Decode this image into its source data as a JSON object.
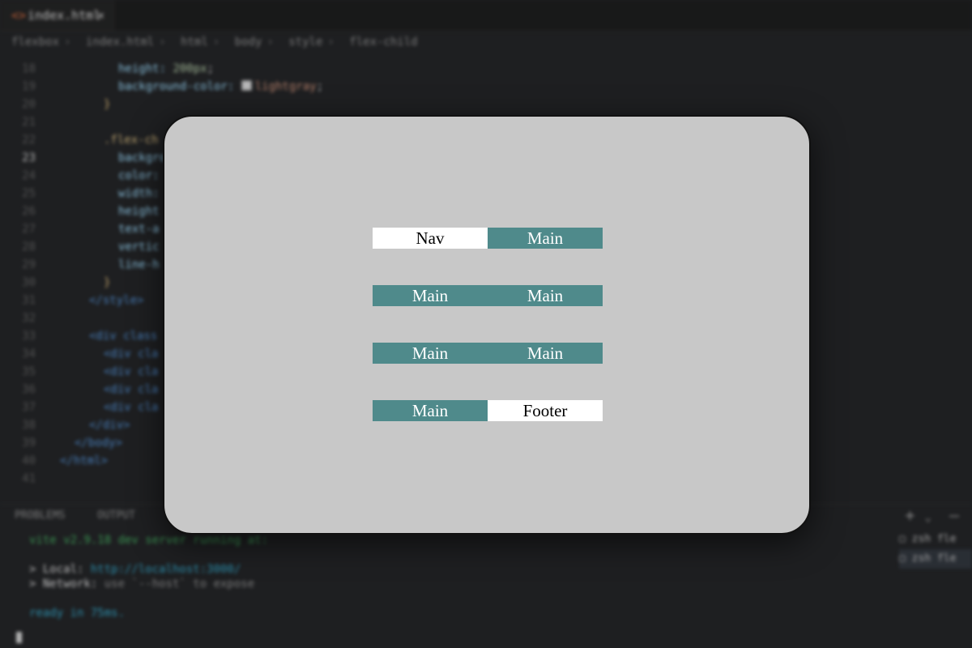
{
  "editor": {
    "tab_icon": "html-file-icon",
    "tab_name": "index.html",
    "tab_close": "×",
    "breadcrumb": [
      "flexbox",
      "index.html",
      "html",
      "body",
      "style",
      "flex-child"
    ],
    "line_numbers": [
      "18",
      "19",
      "20",
      "21",
      "22",
      "23",
      "24",
      "25",
      "26",
      "27",
      "28",
      "29",
      "30",
      "31",
      "32",
      "33",
      "34",
      "35",
      "36",
      "37",
      "38",
      "39",
      "40",
      "41"
    ],
    "lines": {
      "l18_prop": "height: ",
      "l18_val": "200px",
      "l19_prop": "background-color: ",
      "l19_val": "lightgray",
      "l20": "}",
      "l22": ".flex-ch",
      "l23": "backgro",
      "l24": "color:",
      "l25": "width:",
      "l26": "height",
      "l27": "text-a",
      "l28": "vertic",
      "l29": "line-h",
      "l30": "}",
      "l31": "</style>",
      "l33": "<div class",
      "l34": "<div cla",
      "l35": "<div cla",
      "l36": "<div cla",
      "l37": "<div cla",
      "l38": "</div>",
      "l39": "</body>",
      "l40": "</html>"
    }
  },
  "panel": {
    "tabs": [
      "PROBLEMS",
      "OUTPUT"
    ],
    "add": "+",
    "chevron": "⌄",
    "minimize": "—"
  },
  "terminal": {
    "line1": "vite v2.9.18 dev server running at:",
    "local_label": "> Local: ",
    "local_url": "http://localhost:3000/",
    "network_label": "> Network: ",
    "network_text": "use `--host` to expose",
    "ready": "ready in 75ms."
  },
  "shells": [
    "zsh fle",
    "zsh fle"
  ],
  "preview": {
    "items": [
      {
        "label": "Nav",
        "style": "white"
      },
      {
        "label": "Main",
        "style": "teal"
      },
      {
        "label": "Main",
        "style": "teal"
      },
      {
        "label": "Main",
        "style": "teal"
      },
      {
        "label": "Main",
        "style": "teal"
      },
      {
        "label": "Main",
        "style": "teal"
      },
      {
        "label": "Main",
        "style": "teal"
      },
      {
        "label": "Footer",
        "style": "white"
      }
    ],
    "colors": {
      "teal": "#4f8a8b",
      "white": "#ffffff",
      "background": "#c8c8c8"
    }
  }
}
